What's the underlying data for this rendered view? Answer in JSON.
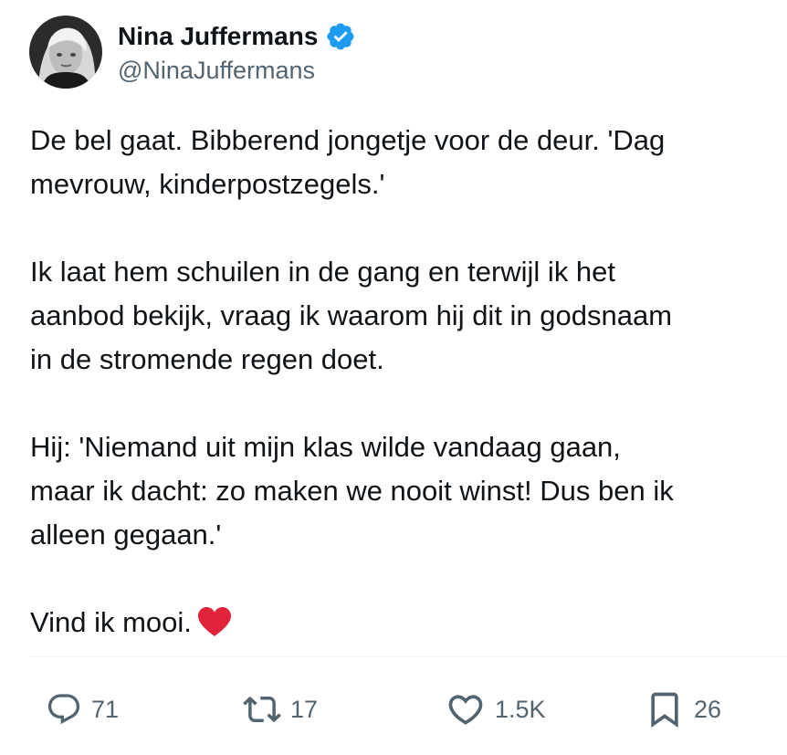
{
  "user": {
    "name": "Nina Juffermans",
    "handle": "@NinaJuffermans",
    "verified_color": "#1d9bf0"
  },
  "tweet": {
    "paragraphs": [
      [
        "De bel gaat. Bibberend jongetje voor de deur. 'Dag",
        "mevrouw, kinderpostzegels.'"
      ],
      [
        "Ik laat hem schuilen in de gang en terwijl ik het",
        "aanbod bekijk, vraag ik waarom hij dit in godsnaam",
        "in de stromende regen doet."
      ],
      [
        "Hij: 'Niemand uit mijn klas wilde vandaag gaan,",
        "maar ik dacht: zo maken we nooit winst! Dus ben ik",
        "alleen gegaan.'"
      ],
      [
        "Vind ik mooi."
      ]
    ],
    "emoji": "red-heart"
  },
  "actions": {
    "replies": "71",
    "retweets": "17",
    "likes": "1.5K",
    "bookmarks": "26"
  },
  "colors": {
    "text": "#0f1419",
    "secondary": "#536471",
    "heart": "#e0233b",
    "divider": "#eff3f4"
  }
}
